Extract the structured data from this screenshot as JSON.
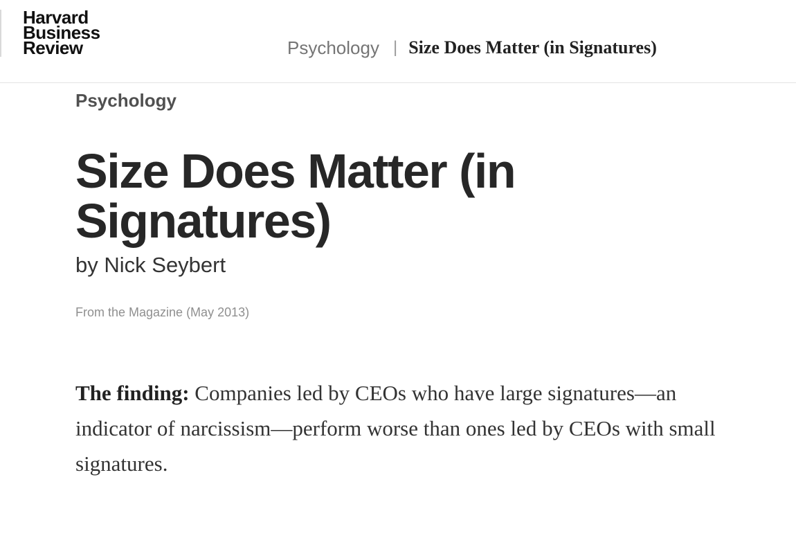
{
  "header": {
    "logo_lines": [
      "Harvard",
      "Business",
      "Review"
    ],
    "breadcrumb": {
      "topic": "Psychology",
      "separator": "|",
      "title": "Size Does Matter (in Signatures)"
    }
  },
  "article": {
    "topic": "Psychology",
    "headline": "Size Does Matter (in Signatures)",
    "byline_prefix": "by",
    "author": "Nick Seybert",
    "source": "From the Magazine (May 2013)",
    "finding_label": "The finding:",
    "finding_text": "Companies led by CEOs who have large signatures—an indicator of narcissism—perform worse than ones led by CEOs with small signatures."
  }
}
